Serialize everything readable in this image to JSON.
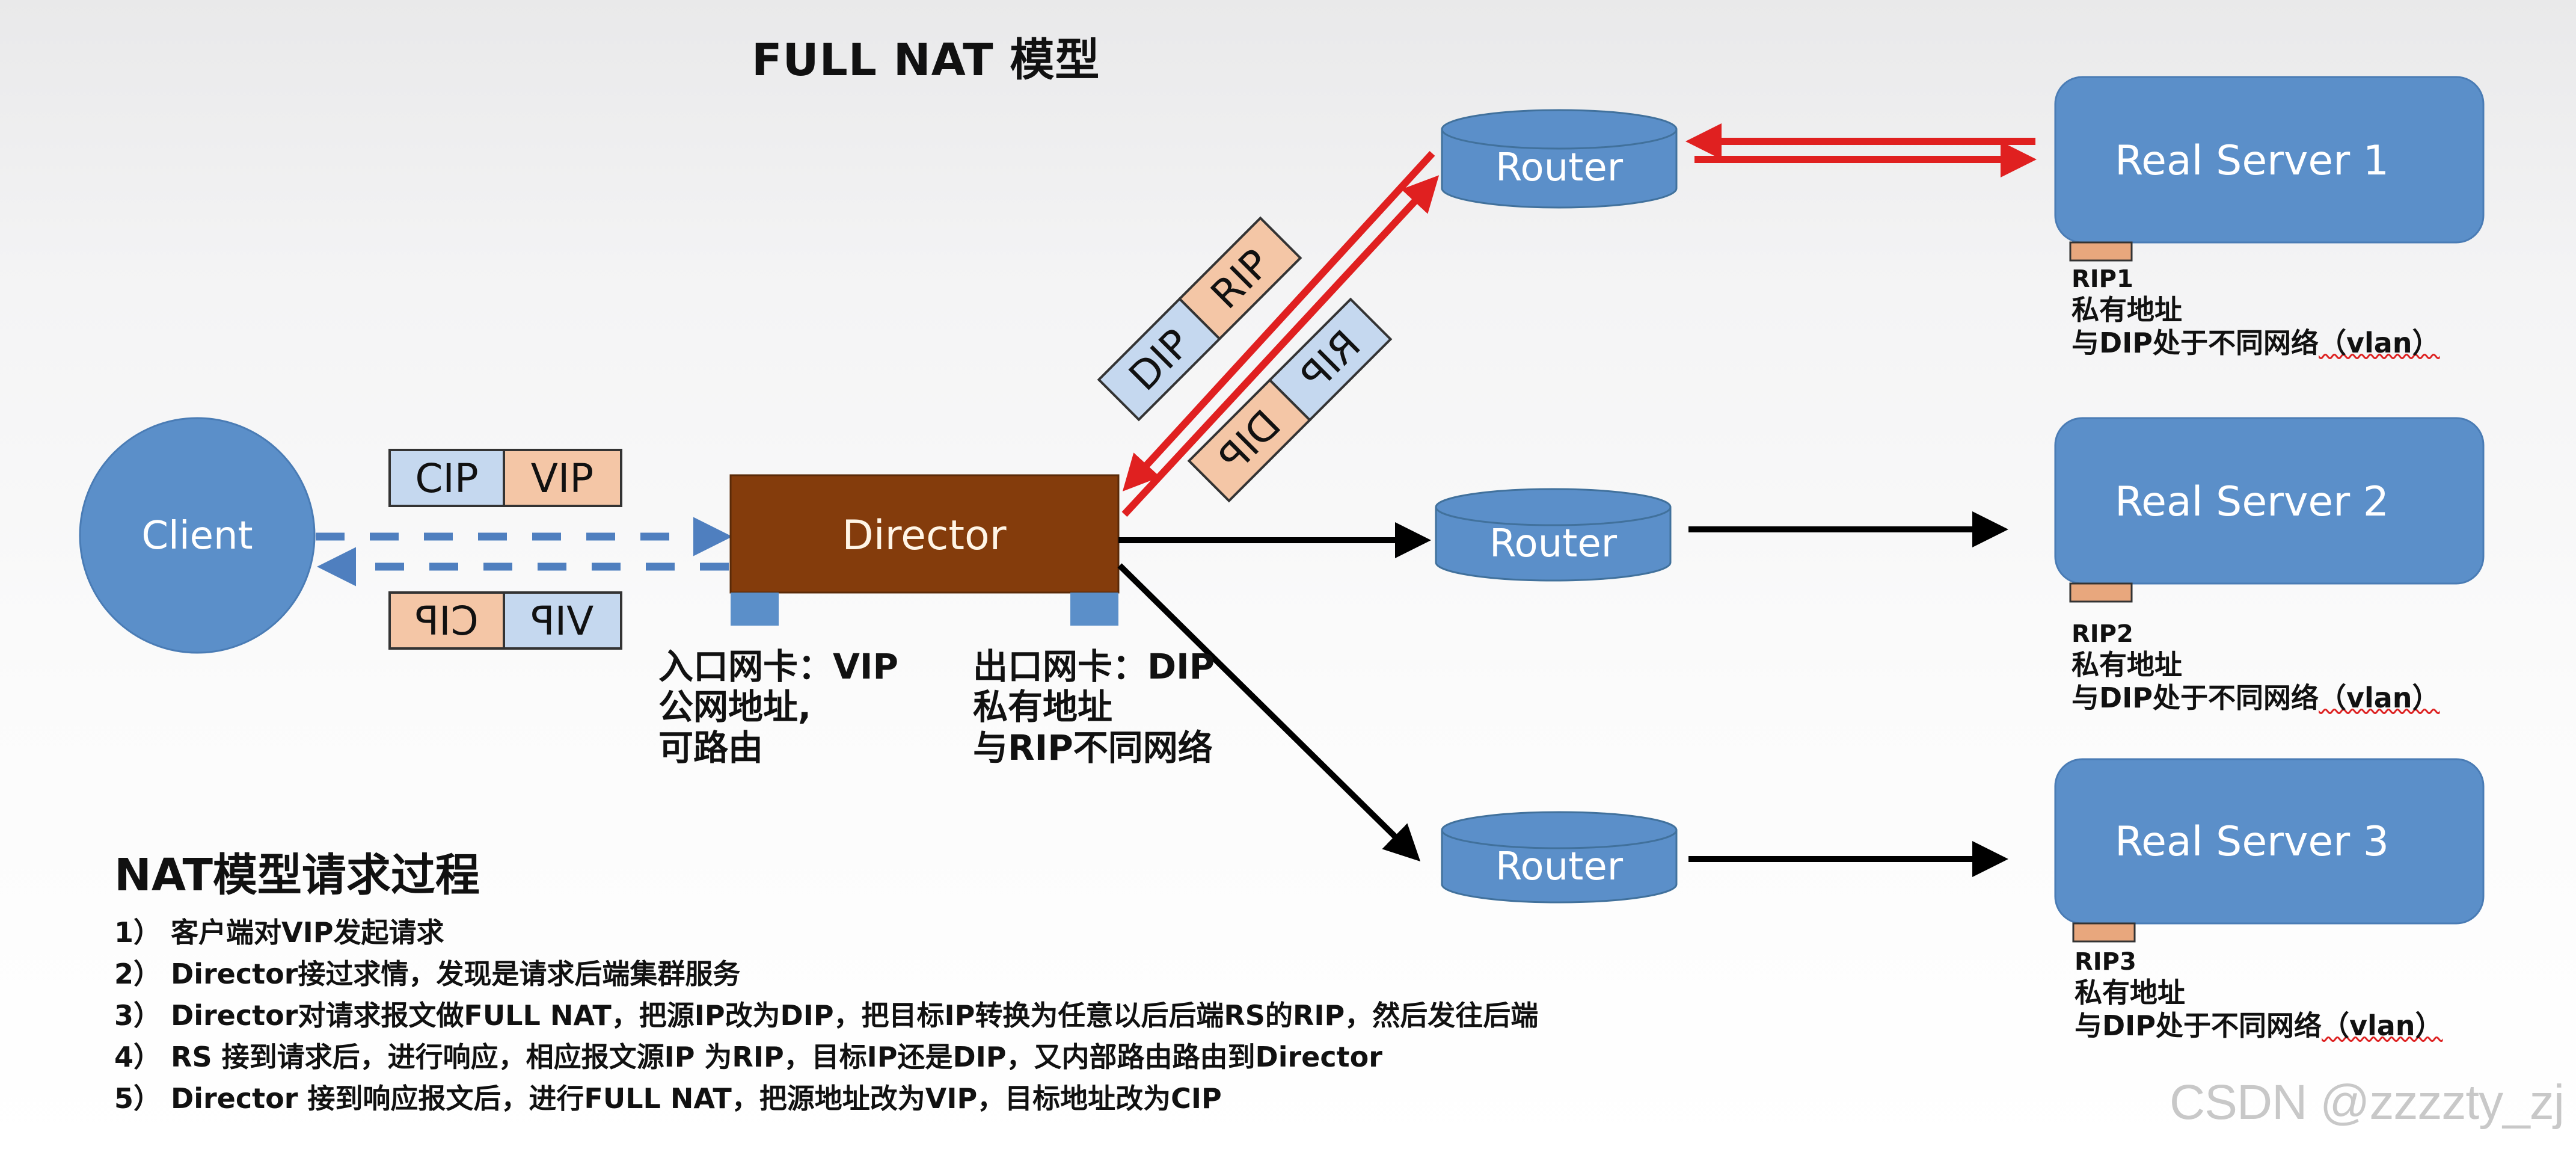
{
  "title": "FULL NAT 模型",
  "colors": {
    "node_blue": "#5b8fc9",
    "node_blue_dark": "#41719c",
    "director_brown": "#843c0c",
    "packet_blue": "#c5d8ef",
    "packet_peach": "#f4c6a6",
    "nic_peach": "#e8a77d",
    "red_arrow": "#e02020",
    "black_arrow": "#000000",
    "dashed_arrow": "#4f7fbf"
  },
  "nodes": {
    "client": "Client",
    "director": "Director",
    "routers": [
      "Router",
      "Router",
      "Router"
    ],
    "real_servers": [
      "Real Server 1",
      "Real Server 2",
      "Real Server 3"
    ]
  },
  "packets": {
    "client_request": [
      "CIP",
      "VIP"
    ],
    "client_response": [
      "CIP",
      "VIP"
    ],
    "director_to_rs": [
      "DIP",
      "RIP"
    ],
    "rs_to_director": [
      "RIP",
      "DIP"
    ]
  },
  "director_captions": {
    "inbound": [
      "入口网卡：VIP",
      "公网地址,",
      "可路由"
    ],
    "outbound": [
      "出口网卡：DIP",
      "私有地址",
      "与RIP不同网络"
    ]
  },
  "rs_captions": [
    {
      "rip": "RIP1",
      "line1": "私有地址",
      "line2": "与DIP处于不同网络",
      "vlan": "（vlan）"
    },
    {
      "rip": "RIP2",
      "line1": "私有地址",
      "line2": "与DIP处于不同网络",
      "vlan": "（vlan）"
    },
    {
      "rip": "RIP3",
      "line1": "私有地址",
      "line2": "与DIP处于不同网络",
      "vlan": "（vlan）"
    }
  ],
  "process": {
    "title": "NAT模型请求过程",
    "steps": [
      "1） 客户端对VIP发起请求",
      "2） Director接过求情，发现是请求后端集群服务",
      "3） Director对请求报文做FULL NAT，把源IP改为DIP，把目标IP转换为任意以后后端RS的RIP，然后发往后端",
      "4） RS 接到请求后，进行响应，相应报文源IP 为RIP，目标IP还是DIP，又内部路由路由到Director",
      "5） Director 接到响应报文后，进行FULL NAT，把源地址改为VIP，目标地址改为CIP"
    ]
  },
  "watermark": "CSDN @zzzzty_zj"
}
